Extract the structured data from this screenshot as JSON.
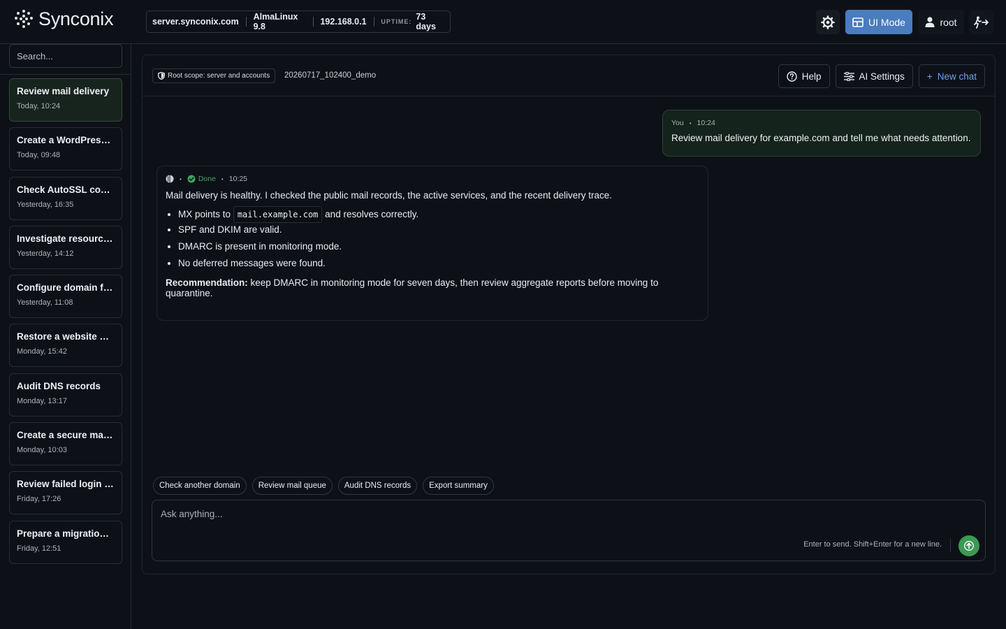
{
  "brand": {
    "name": "Synconix"
  },
  "server": {
    "host": "server.synconix.com",
    "os": "AlmaLinux 9.8",
    "ip": "192.168.0.1",
    "uptime_label": "UPTIME:",
    "uptime_value": "73 days"
  },
  "top_actions": {
    "theme_icon": "gear-icon",
    "ui_mode_label": "UI Mode",
    "user_label": "root",
    "logout_icon": "exit-icon"
  },
  "sidebar": {
    "search_placeholder": "Search...",
    "chats": [
      {
        "title": "Review mail delivery",
        "time": "Today, 10:24",
        "active": true
      },
      {
        "title": "Create a WordPress site",
        "time": "Today, 09:48"
      },
      {
        "title": "Check AutoSSL coverage",
        "time": "Yesterday, 16:35"
      },
      {
        "title": "Investigate resource usage",
        "time": "Yesterday, 14:12"
      },
      {
        "title": "Configure domain forwarding",
        "time": "Yesterday, 11:08"
      },
      {
        "title": "Restore a website backup",
        "time": "Monday, 15:42"
      },
      {
        "title": "Audit DNS records",
        "time": "Monday, 13:17"
      },
      {
        "title": "Create a secure mailbox",
        "time": "Monday, 10:03"
      },
      {
        "title": "Review failed login attempts",
        "time": "Friday, 17:26"
      },
      {
        "title": "Prepare a migration plan",
        "time": "Friday, 12:51"
      }
    ]
  },
  "header": {
    "scope_label": "Root scope: server and accounts",
    "session_id": "20260717_102400_demo",
    "help_label": "Help",
    "ai_settings_label": "AI Settings",
    "new_chat_label": "New chat"
  },
  "messages": {
    "user": {
      "author": "You",
      "time": "10:24",
      "text": "Review mail delivery for example.com and tell me what needs attention."
    },
    "assistant": {
      "status": "Done",
      "time": "10:25",
      "intro": "Mail delivery is healthy. I checked the public mail records, the active services, and the recent delivery trace.",
      "bullet_mx_prefix": "MX points to",
      "bullet_mx_code": "mail.example.com",
      "bullet_mx_suffix": "and resolves correctly.",
      "bullet_2": "SPF and DKIM are valid.",
      "bullet_3": "DMARC is present in monitoring mode.",
      "bullet_4": "No deferred messages were found.",
      "rec_label": "Recommendation:",
      "rec_text": "keep DMARC in monitoring mode for seven days, then review aggregate reports before moving to quarantine."
    }
  },
  "suggestions": [
    "Check another domain",
    "Review mail queue",
    "Audit DNS records",
    "Export summary"
  ],
  "composer": {
    "placeholder": "Ask anything...",
    "hint": "Enter to send. Shift+Enter for a new line."
  },
  "colors": {
    "accent_blue": "#4a7cbf",
    "success_green": "#3c9a53",
    "background": "#0d1117"
  }
}
